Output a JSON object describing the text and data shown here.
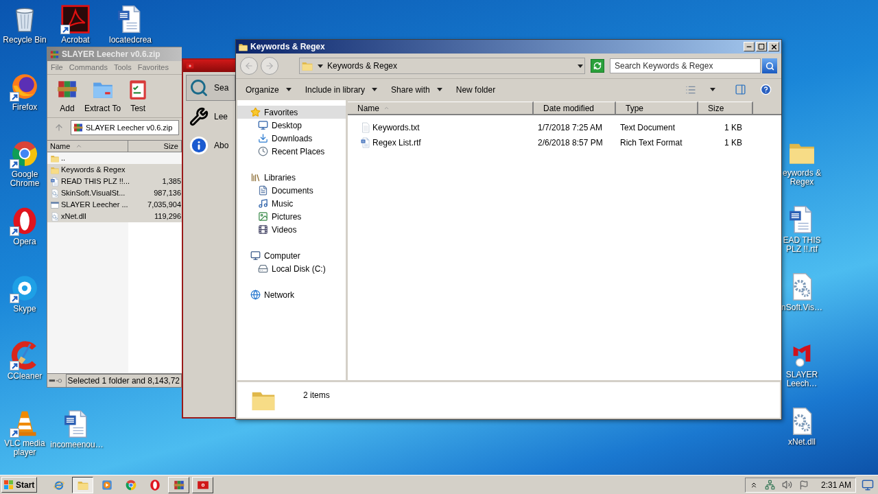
{
  "desktop": {
    "icons_left": [
      {
        "label": "Recycle Bin",
        "kind": "trash",
        "shortcut": false
      },
      {
        "label": "Firefox",
        "kind": "firefox",
        "shortcut": true
      },
      {
        "label": "Google Chrome",
        "kind": "chrome",
        "shortcut": true
      },
      {
        "label": "Opera",
        "kind": "opera",
        "shortcut": true
      },
      {
        "label": "Skype",
        "kind": "skype",
        "shortcut": true
      },
      {
        "label": "CCleaner",
        "kind": "ccleaner",
        "shortcut": true
      },
      {
        "label": "VLC media player",
        "kind": "vlc",
        "shortcut": true
      }
    ],
    "icons_top": [
      {
        "label": "Acrobat",
        "kind": "acrobat",
        "shortcut": true
      },
      {
        "label": "locatedcrea",
        "kind": "document",
        "shortcut": false
      }
    ],
    "icons_bottom": [
      {
        "label": "incomeenou…",
        "kind": "document",
        "shortcut": false
      }
    ],
    "icons_right": [
      {
        "label": "eywords & Regex",
        "kind": "folder",
        "shortcut": false
      },
      {
        "label": "EAD THIS PLZ !!.rtf",
        "kind": "document",
        "shortcut": false
      },
      {
        "label": "nSoft.Vis…",
        "kind": "gear",
        "shortcut": false
      },
      {
        "label": "SLAYER Leech…",
        "kind": "slayer",
        "shortcut": false
      },
      {
        "label": "xNet.dll",
        "kind": "gear",
        "shortcut": false
      }
    ]
  },
  "winrar": {
    "title": "SLAYER Leecher v0.6.zip",
    "active": false,
    "menu": [
      "File",
      "Commands",
      "Tools",
      "Favorites"
    ],
    "toolbar": [
      {
        "label": "Add",
        "kind": "winrar"
      },
      {
        "label": "Extract To",
        "kind": "folderblue"
      },
      {
        "label": "Test",
        "kind": "clipboard"
      }
    ],
    "path": "SLAYER Leecher v0.6.zip",
    "columns": [
      {
        "label": "Name",
        "sorted": true
      },
      {
        "label": "Size",
        "sorted": false
      }
    ],
    "rows": [
      {
        "name": "..",
        "kind": "folder",
        "selected": false
      },
      {
        "name": "Keywords & Regex",
        "kind": "folder",
        "selected": true
      },
      {
        "name": "READ THIS PLZ !!...",
        "size": "1,385",
        "kind": "document",
        "selected": true
      },
      {
        "name": "SkinSoft.VisualSt...",
        "size": "987,136",
        "kind": "gear",
        "selected": true
      },
      {
        "name": "SLAYER Leecher ...",
        "size": "7,035,904",
        "kind": "exe",
        "selected": true
      },
      {
        "name": "xNet.dll",
        "size": "119,296",
        "kind": "gear",
        "selected": true
      }
    ],
    "status": "Selected 1 folder and 8,143,72"
  },
  "app_window": {
    "items": [
      {
        "label": "Sea",
        "kind": "search",
        "selected": true
      },
      {
        "label": "Lee",
        "kind": "tools",
        "selected": false
      },
      {
        "label": "Abo",
        "kind": "info",
        "selected": false
      }
    ]
  },
  "explorer": {
    "title": "Keywords & Regex",
    "active": true,
    "address": "Keywords & Regex",
    "search_placeholder": "Search Keywords & Regex",
    "toolbar": [
      {
        "label": "Organize",
        "dropdown": true
      },
      {
        "label": "Include in library",
        "dropdown": true
      },
      {
        "label": "Share with",
        "dropdown": true
      },
      {
        "label": "New folder",
        "dropdown": false
      }
    ],
    "nav_tree": [
      {
        "label": "Favorites",
        "kind": "star",
        "selected": true,
        "children": [
          {
            "label": "Desktop",
            "kind": "desktop",
            "selected": false
          },
          {
            "label": "Downloads",
            "kind": "downloads",
            "selected": false
          },
          {
            "label": "Recent Places",
            "kind": "recent",
            "selected": false
          }
        ]
      },
      {
        "label": "Libraries",
        "kind": "library",
        "selected": false,
        "children": [
          {
            "label": "Documents",
            "kind": "documents",
            "selected": false
          },
          {
            "label": "Music",
            "kind": "music",
            "selected": false
          },
          {
            "label": "Pictures",
            "kind": "pictures",
            "selected": false
          },
          {
            "label": "Videos",
            "kind": "videos",
            "selected": false
          }
        ]
      },
      {
        "label": "Computer",
        "kind": "computer",
        "selected": false,
        "children": [
          {
            "label": "Local Disk (C:)",
            "kind": "disk",
            "selected": false
          }
        ]
      },
      {
        "label": "Network",
        "kind": "network",
        "selected": false
      }
    ],
    "columns": [
      {
        "label": "Name",
        "sorted": true
      },
      {
        "label": "Date modified",
        "sorted": false
      },
      {
        "label": "Type",
        "sorted": false
      },
      {
        "label": "Size",
        "sorted": false
      }
    ],
    "rows": [
      {
        "name": "Keywords.txt",
        "kind": "text",
        "date": "1/7/2018 7:25 AM",
        "type": "Text Document",
        "size": "1 KB"
      },
      {
        "name": "Regex List.rtf",
        "kind": "document",
        "date": "2/6/2018 8:57 PM",
        "type": "Rich Text Format",
        "size": "1 KB"
      }
    ],
    "details": "2 items"
  },
  "taskbar": {
    "start": "Start",
    "items": [
      {
        "kind": "ie",
        "running": false,
        "selected": false
      },
      {
        "kind": "folder",
        "running": true,
        "selected": true
      },
      {
        "kind": "player",
        "running": false,
        "selected": false
      },
      {
        "kind": "chrome",
        "running": false,
        "selected": false
      },
      {
        "kind": "opera",
        "running": false,
        "selected": false
      },
      {
        "kind": "winrar",
        "running": true,
        "selected": false
      },
      {
        "kind": "redapp",
        "running": true,
        "selected": false
      }
    ],
    "clock": "2:31 AM"
  }
}
